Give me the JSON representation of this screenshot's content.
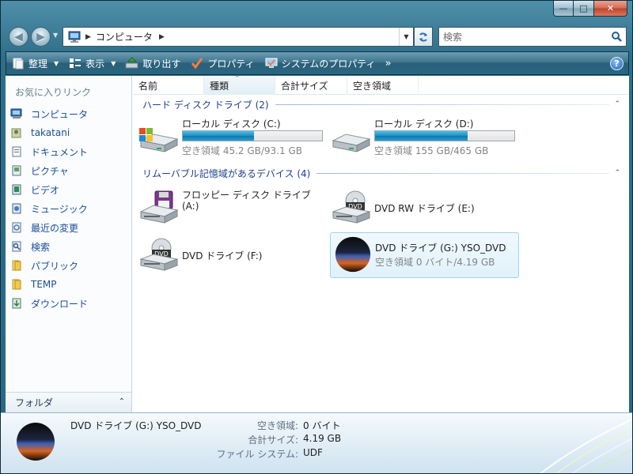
{
  "window": {
    "caption_buttons": {
      "minimize": "—",
      "maximize": "□",
      "close": "✕"
    }
  },
  "nav": {
    "back_glyph": "◀",
    "forward_glyph": "▶",
    "address": {
      "location": "コンピュータ",
      "separator": "▶",
      "trailing_separator": "▶"
    },
    "search_placeholder": "検索"
  },
  "commandbar": {
    "items": [
      {
        "label": "整理",
        "icon": "organize-icon",
        "has_dropdown": true
      },
      {
        "label": "表示",
        "icon": "views-icon",
        "has_dropdown": true
      },
      {
        "label": "取り出す",
        "icon": "eject-icon",
        "has_dropdown": false
      },
      {
        "label": "プロパティ",
        "icon": "properties-check-icon",
        "has_dropdown": false
      },
      {
        "label": "システムのプロパティ",
        "icon": "system-properties-icon",
        "has_dropdown": false
      }
    ],
    "more": "»",
    "help": "?"
  },
  "navpane": {
    "title": "お気に入りリンク",
    "items": [
      {
        "label": "コンピュータ",
        "icon": "computer-icon"
      },
      {
        "label": "takatani",
        "icon": "user-folder-icon"
      },
      {
        "label": "ドキュメント",
        "icon": "documents-icon"
      },
      {
        "label": "ピクチャ",
        "icon": "pictures-icon"
      },
      {
        "label": "ビデオ",
        "icon": "videos-icon"
      },
      {
        "label": "ミュージック",
        "icon": "music-icon"
      },
      {
        "label": "最近の変更",
        "icon": "recent-changes-icon"
      },
      {
        "label": "検索",
        "icon": "search-folder-icon"
      },
      {
        "label": "パブリック",
        "icon": "folder-icon"
      },
      {
        "label": "TEMP",
        "icon": "folder-icon"
      },
      {
        "label": "ダウンロード",
        "icon": "downloads-icon"
      }
    ],
    "folders_label": "フォルダ",
    "folders_chevron": "⌃"
  },
  "columns": [
    {
      "label": "名前",
      "sorted": false
    },
    {
      "label": "種類",
      "sorted": true
    },
    {
      "label": "合計サイズ",
      "sorted": false
    },
    {
      "label": "空き領域",
      "sorted": false
    }
  ],
  "groups": {
    "hard_disks": {
      "title": "ハード ディスク ドライブ (2)",
      "toggle": "⌃"
    },
    "removable": {
      "title": "リムーバブル記憶域があるデバイス (4)",
      "toggle": "⌃"
    }
  },
  "drives": {
    "c": {
      "name": "ローカル ディスク (C:)",
      "free": "空き領域 45.2 GB/93.1 GB",
      "used_fraction": 0.514,
      "icon": "windows-hard-disk-icon"
    },
    "d": {
      "name": "ローカル ディスク (D:)",
      "free": "空き領域 155 GB/465 GB",
      "used_fraction": 0.667,
      "icon": "hard-disk-icon"
    },
    "a": {
      "name_line1": "フロッピー ディスク ドライブ",
      "name_line2": "(A:)",
      "icon": "floppy-drive-icon"
    },
    "e": {
      "name": "DVD RW ドライブ (E:)",
      "icon": "dvd-rw-drive-icon",
      "badge": "DVD"
    },
    "f": {
      "name": "DVD ドライブ (F:)",
      "icon": "dvd-drive-icon",
      "badge": "DVD"
    },
    "g": {
      "name": "DVD ドライブ (G:) YSO_DVD",
      "free": "空き領域 0 バイト/4.19 GB",
      "icon": "dvd-disc-custom-icon",
      "selected": true
    }
  },
  "details": {
    "name": "DVD ドライブ (G:) YSO_DVD",
    "props": [
      {
        "key": "空き領域:",
        "value": "0 バイト"
      },
      {
        "key": "合計サイズ:",
        "value": "4.19 GB"
      },
      {
        "key": "ファイル システム:",
        "value": "UDF"
      }
    ]
  },
  "colors": {
    "frame": "#2f6e8a",
    "link": "#1b4c9a",
    "group_title": "#1e3f8c",
    "progress": "#1e8fc2",
    "selection_border": "#9fd3f2"
  }
}
